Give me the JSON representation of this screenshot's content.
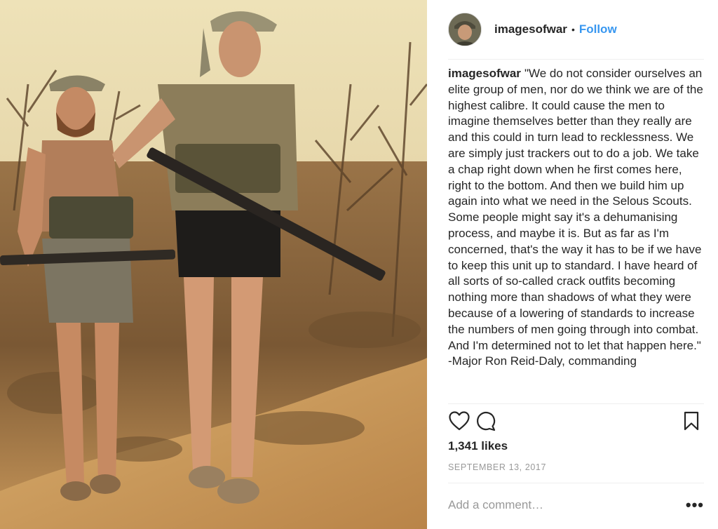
{
  "post": {
    "image_alt": "Two soldiers walking through dry bush carrying rifles",
    "username": "imagesofwar",
    "separator": "•",
    "follow_label": "Follow",
    "caption_user": "imagesofwar",
    "caption_text": "\"We do not consider ourselves an elite group of men, nor do we think we are of the highest calibre. It could cause the men to imagine themselves better than they really are and this could in turn lead to recklessness. We are simply just trackers out to do a job. We take a chap right down when he first comes here, right to the bottom. And then we build him up again into what we need in the Selous Scouts. Some people might say it's a dehumanising process, and maybe it is. But as far as I'm concerned, that's the way it has to be if we have to keep this unit up to standard. I have heard of all sorts of so-called crack outfits becoming nothing more than shadows of what they were because of a lowering of standards to increase the numbers of men going through into combat. And I'm determined not to let that happen here.\" -Major Ron Reid-Daly, commanding",
    "likes": "1,341 likes",
    "date": "SEPTEMBER 13, 2017",
    "comment_placeholder": "Add a comment…",
    "more_label": "•••"
  },
  "icons": {
    "like": "heart-icon",
    "comment": "speech-bubble-icon",
    "save": "bookmark-icon",
    "more": "more-options-icon"
  },
  "colors": {
    "link": "#3897f0",
    "text": "#262626",
    "muted": "#999999",
    "divider": "#efefef"
  }
}
